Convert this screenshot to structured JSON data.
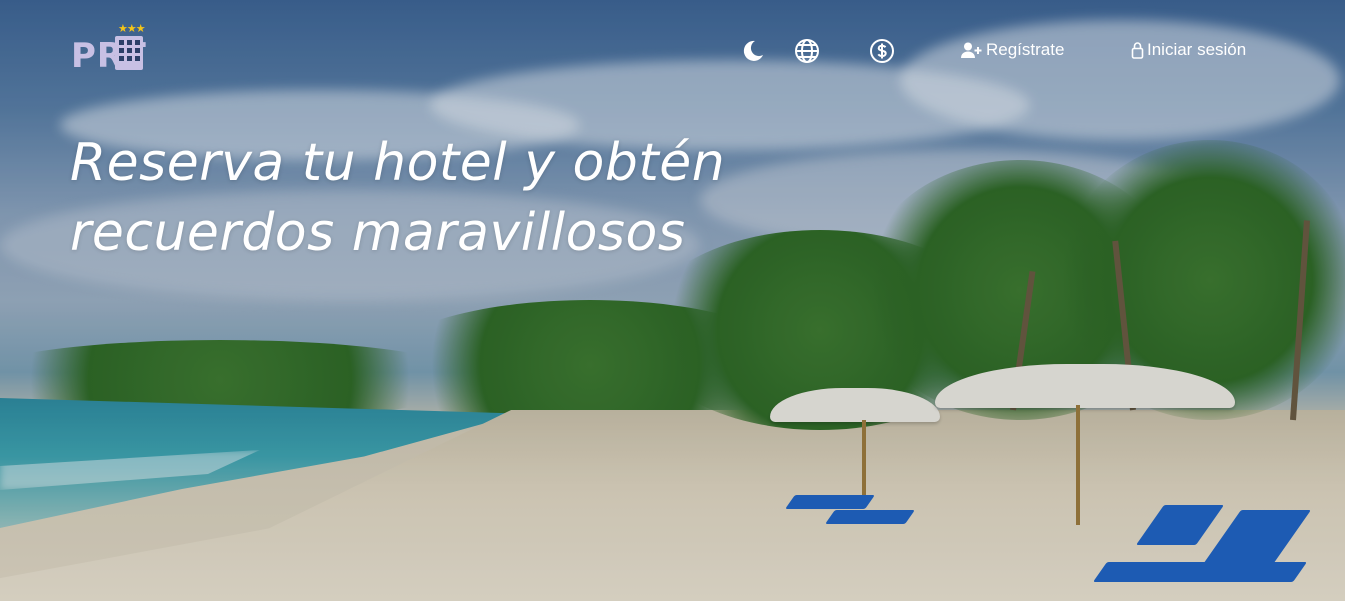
{
  "brand": {
    "name": "PRT",
    "logo_icon": "hotel-building-stars-icon",
    "accent": "#c8c0e4",
    "star_color": "#f5c518",
    "stars": "★★★"
  },
  "nav": {
    "theme_toggle_icon": "moon-icon",
    "language_icon": "globe-icon",
    "currency_icon": "dollar-circle-icon",
    "register": {
      "label": "Regístrate",
      "icon": "user-plus-icon"
    },
    "login": {
      "label": "Iniciar sesión",
      "icon": "lock-icon"
    }
  },
  "hero": {
    "headline_line1": "Reserva tu hotel y obtén",
    "headline_line2": "recuerdos maravillosos",
    "image": "tropical-beach-with-palms-and-umbrellas"
  }
}
